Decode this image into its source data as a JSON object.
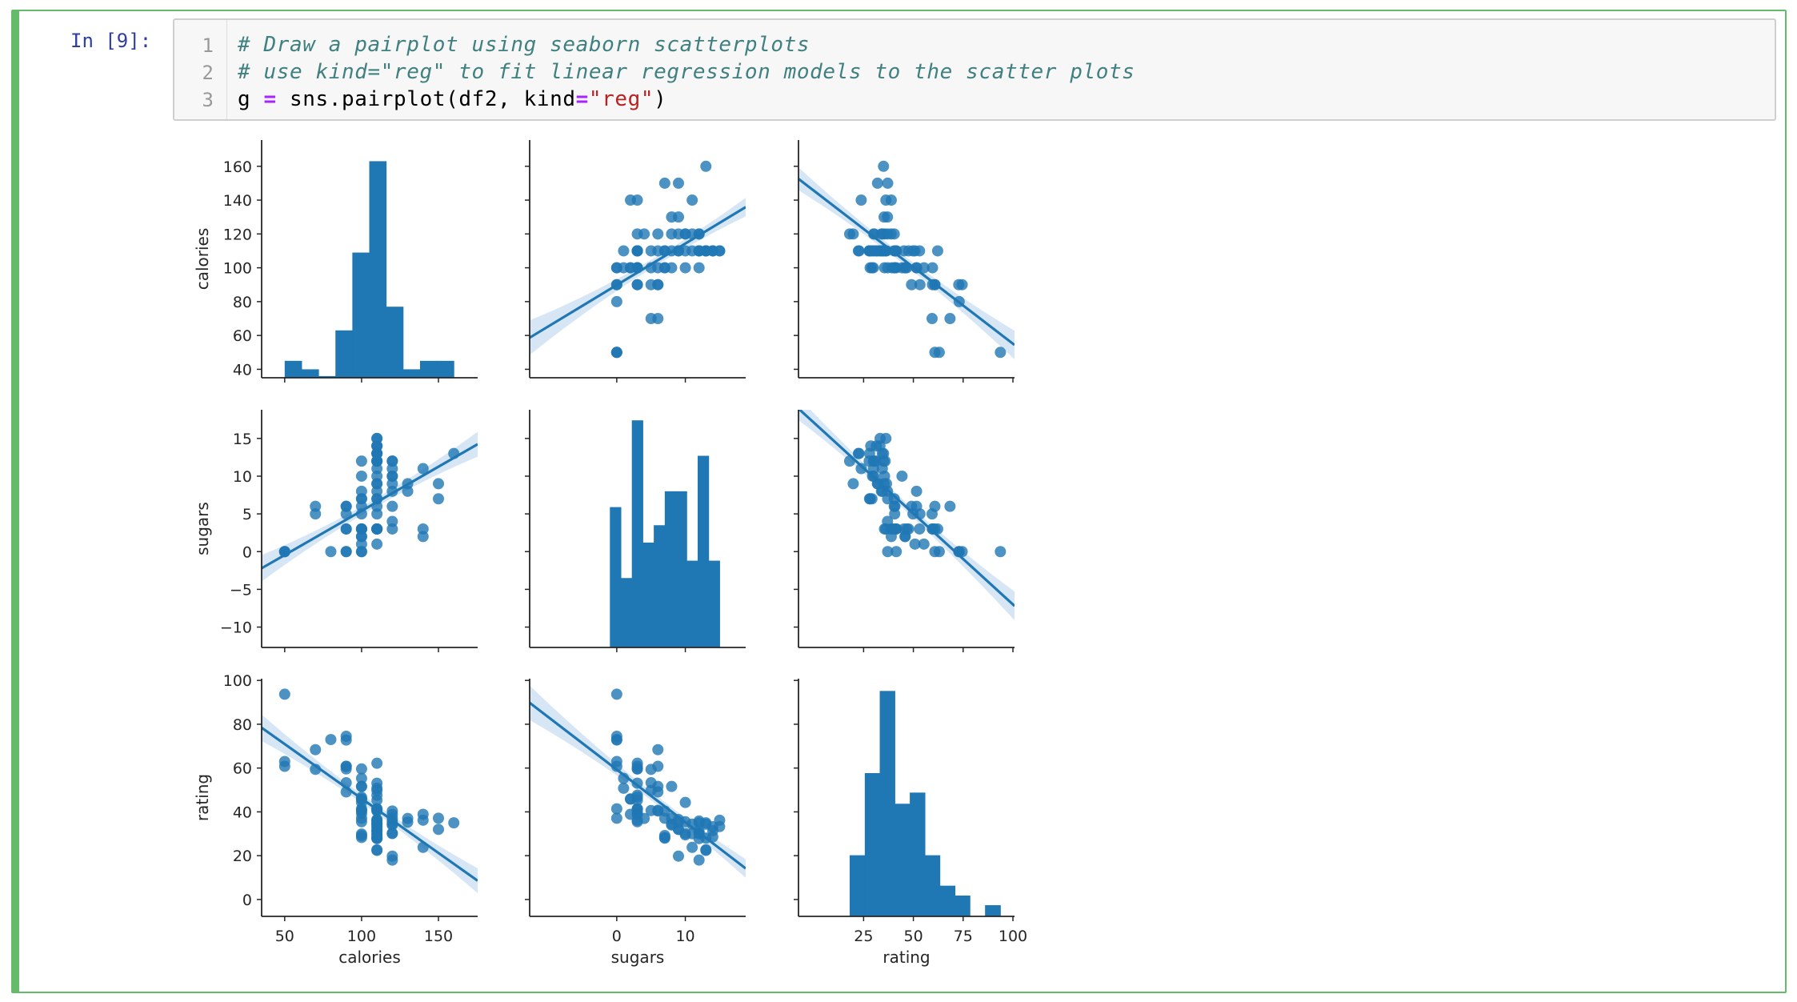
{
  "cell": {
    "prompt": "In [9]:",
    "line_numbers": [
      "1",
      "2",
      "3"
    ],
    "lines": [
      [
        {
          "t": "# Draw a pairplot using seaborn scatterplots",
          "c": "comment"
        }
      ],
      [
        {
          "t": "# use kind=\"reg\" to fit linear regression models to the scatter plots",
          "c": "comment"
        }
      ],
      [
        {
          "t": "g ",
          "c": ""
        },
        {
          "t": "=",
          "c": "op"
        },
        {
          "t": " sns.pairplot(df2, kind",
          "c": ""
        },
        {
          "t": "=",
          "c": "op"
        },
        {
          "t": "\"reg\"",
          "c": "str"
        },
        {
          "t": ")",
          "c": ""
        }
      ]
    ]
  },
  "colors": {
    "cell_border": "#66bb6a",
    "prompt": "#303f9f",
    "mark": "#1f77b4",
    "ci_band": "#c6dbef"
  },
  "chart_data": {
    "type": "pairplot",
    "kind": "reg",
    "variables": [
      "calories",
      "sugars",
      "rating"
    ],
    "axis_labels": {
      "calories": "calories",
      "sugars": "sugars",
      "rating": "rating"
    },
    "limits": {
      "calories": [
        35,
        175.5
      ],
      "sugars": [
        -12.7,
        18.8
      ],
      "rating": [
        -7.7,
        100.8
      ]
    },
    "ticks": {
      "calories_y": [
        40,
        60,
        80,
        100,
        120,
        140,
        160
      ],
      "calories_x": [
        50,
        100,
        150
      ],
      "sugars_y": [
        -10,
        -5,
        0,
        5,
        10,
        15
      ],
      "sugars_x": [
        0,
        10
      ],
      "rating_y": [
        0,
        20,
        40,
        60,
        80,
        100
      ],
      "rating_x": [
        25,
        50,
        75,
        100
      ]
    },
    "histograms": {
      "calories": {
        "bin_edges": [
          50,
          61,
          72,
          83,
          94,
          105,
          116,
          127,
          138,
          149,
          160
        ],
        "heights_in_axis_units": [
          45,
          40,
          36,
          63,
          109,
          163,
          77,
          40,
          45,
          45
        ]
      },
      "sugars": {
        "bin_edges": [
          -1,
          0.6,
          2.2,
          3.8,
          5.4,
          7.0,
          8.6,
          10.2,
          11.8,
          13.4,
          15
        ],
        "heights_in_axis_units": [
          5.9,
          -3.5,
          17.4,
          1.2,
          3.5,
          8.0,
          8.0,
          -1.2,
          12.7,
          -1.2
        ]
      },
      "rating": {
        "bin_edges": [
          18.0,
          25.6,
          33.1,
          40.7,
          48.2,
          55.8,
          63.3,
          70.9,
          78.4,
          86.0,
          93.7
        ],
        "heights_in_axis_units": [
          20.2,
          57.7,
          95.2,
          43.7,
          48.8,
          20.2,
          6.3,
          1.8,
          null,
          -2.6
        ]
      }
    },
    "regression": {
      "sugars_vs_calories": {
        "slope": 0.117,
        "intercept": -6.3
      },
      "rating_vs_calories": {
        "slope": -0.497,
        "intercept": 95.8
      },
      "calories_vs_sugars": {
        "slope": 2.45,
        "intercept": 89.8
      },
      "rating_vs_sugars": {
        "slope": -2.4,
        "intercept": 59.3
      },
      "calories_vs_rating": {
        "slope": -0.905,
        "intercept": 145.6
      },
      "sugars_vs_rating": {
        "slope": -0.241,
        "intercept": 17.1
      }
    },
    "points": {
      "calories": [
        70,
        120,
        70,
        50,
        110,
        110,
        110,
        130,
        90,
        90,
        120,
        110,
        120,
        110,
        110,
        110,
        100,
        110,
        110,
        110,
        100,
        110,
        100,
        100,
        110,
        110,
        100,
        120,
        120,
        110,
        100,
        110,
        100,
        110,
        120,
        120,
        110,
        110,
        110,
        140,
        110,
        100,
        110,
        100,
        150,
        150,
        160,
        100,
        120,
        140,
        90,
        130,
        120,
        100,
        50,
        50,
        100,
        100,
        120,
        100,
        90,
        110,
        110,
        80,
        90,
        90,
        110,
        110,
        90,
        110,
        140,
        100,
        110,
        110,
        100,
        100,
        110
      ],
      "sugars": [
        6,
        8,
        5,
        0,
        8,
        10,
        14,
        8,
        6,
        5,
        12,
        1,
        9,
        7,
        13,
        3,
        2,
        12,
        13,
        7,
        0,
        3,
        10,
        5,
        13,
        11,
        7,
        10,
        12,
        12,
        1,
        9,
        7,
        14,
        3,
        11,
        6,
        9,
        3,
        2,
        12,
        3,
        13,
        6,
        9,
        7,
        13,
        3,
        4,
        11,
        6,
        9,
        10,
        2,
        0,
        0,
        3,
        0,
        6,
        12,
        3,
        15,
        3,
        0,
        0,
        0,
        3,
        5,
        3,
        14,
        3,
        3,
        12,
        3,
        3,
        8,
        15
      ],
      "rating": [
        68.4,
        34.0,
        59.4,
        93.7,
        34.4,
        29.5,
        33.2,
        37.0,
        49.1,
        53.3,
        18.0,
        50.8,
        19.8,
        40.4,
        22.7,
        41.4,
        45.9,
        35.8,
        22.4,
        28.0,
        41.4,
        53.1,
        44.3,
        40.6,
        34.4,
        30.0,
        28.3,
        35.5,
        30.3,
        35.0,
        55.3,
        36.5,
        29.2,
        31.4,
        38.8,
        34.4,
        40.7,
        32.0,
        45.3,
        38.9,
        31.1,
        35.5,
        28.0,
        51.6,
        32.0,
        37.1,
        35.0,
        40.6,
        37.0,
        23.8,
        60.8,
        35.3,
        30.1,
        45.8,
        60.8,
        63.0,
        59.6,
        37.1,
        40.4,
        29.9,
        60.8,
        33.3,
        47.6,
        73.0,
        72.8,
        74.5,
        62.2,
        49.8,
        59.6,
        28.6,
        36.2,
        39.3,
        27.8,
        41.4,
        46.7,
        51.6,
        36.2
      ]
    }
  }
}
